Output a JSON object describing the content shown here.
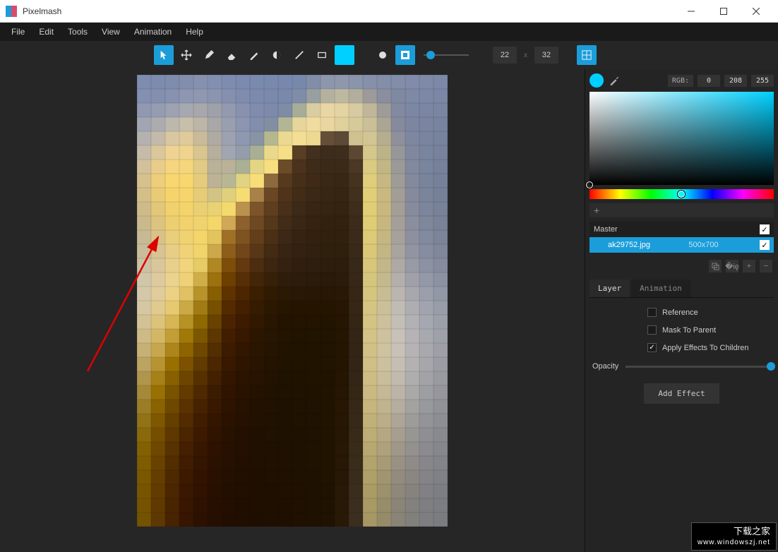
{
  "window": {
    "title": "Pixelmash"
  },
  "menu": {
    "file": "File",
    "edit": "Edit",
    "tools": "Tools",
    "view": "View",
    "animation": "Animation",
    "help": "Help"
  },
  "toolbar": {
    "dim_w": "22",
    "dim_x": "x",
    "dim_h": "32",
    "color": "#00d0ff"
  },
  "color_panel": {
    "mode_label": "RGB:",
    "r": "0",
    "g": "208",
    "b": "255",
    "swatch": "#00d0ff"
  },
  "layers": {
    "master": {
      "name": "Master"
    },
    "items": [
      {
        "name": "ak29752.jpg",
        "dim": "500x700"
      }
    ]
  },
  "tabs": {
    "layer": "Layer",
    "animation": "Animation"
  },
  "layer_props": {
    "reference": "Reference",
    "mask": "Mask To Parent",
    "apply": "Apply Effects To Children",
    "opacity_label": "Opacity",
    "add_effect": "Add Effect"
  },
  "watermark": {
    "line1": "下载之家",
    "line2": "www.windowszj.net"
  },
  "pixel_image": {
    "width": 22,
    "height": 32,
    "rows": [
      "7e8cb0 7d8baf 7f8cae 838ead 8691b0 828fb1 7e8caf 7b8aae 7a8aaf 7989ae 7888ad 7888ab 828ea8 8c96ac 8e97ab 8a94aa 8690a9 838ea9 828daa 808ca9 7e8aa8 7c88a7",
      "8490b0 838fae 8692af 8d97b1 8f98b0 8b95af 8490ae 7f8cad 7c8aad 7a89ac 7989ab 808da8 97a09f b4b29f bdb8a0 b2ae9e 9c9a9a 8a8e9e 8089a2 7e89a6 7c88a6 7a87a5",
      "9199b2 949cb2 9ca2b2 a6a8b0 a7a7ac 9fa1aa 939ab0 8892ae 808cac 7d8aab 7e8ca6 a7ad97 d9cda1 e8d6a4 e5d4a3 d8caa0 c0b79a 9e9c98 8289a0 7c87a4 7a86a3 7986a2",
      "a2a6b3 acacb0 bdb8ae c7beab bcb5a8 a9a7a7 9a9fb0 8c95b1 828eac 828fa2 b2b695 e6d69b f1dca0 ead79f e0d09c d6c99a cabf98 aaa693 858a9c 7c86a1 7985a1 77849f",
      "b4b1b0 c4baa9 d9c7a2 dfca9c c9bb9a afaba2 9da2b1 8f98b1 8893a3 b5b88f ebd991 f4de93 eed992 664f38 5c4936 cfc291 d2c593 b5ae8e 8e919b 7d87a0 79859f 77839d",
      "c5bba8 dac79c eed393 f0d48d d9c590 b5af9c a2a6b2 959daa a9af94 ead98a f6de87 583e24 432f1d 3d2c1b 3d2d1c 5c4832 d5c68b bcb389 969799 7f889f 79859e 77839c",
      "d2c19b e8cd8a f5d67e f5d67c e1ca85 bab199 a9abafa aab094 e3d585 f7df80 6a4c28 4b321c 3f2b19 3c2a18 3b2a18 4a3824 dbca82 c1b685 9b9a99 81899e 79859c 76829a",
      "d6c08d ecce7b f8d670 f8d770 e5cc7c bdb296 b8b795 e0d381 f7de78 8c6a3e 573a1e 462f19 3e2a17 3a2816 392715 453320 e0cd7c c6b882 9f9c97 838a9d 79849b 768199",
      "d4bf89 e9cb77 f6d46c f7d56c e6cc78 d2c484 e0d07e f6dc72 a88148 6a4623 4f341a 422c17 3b2816 382614 372513 41301d e2ce78 c8b980 a29d96 858b9c 7a849b 768198",
      "cfbb89 e2c779 f1d16d f4d36b ead073 e8d273 f4d96c bb914e 7d5429 5e3e1e 49301a 3d2917 382513 352412 352311 3f2d1b e1cd75 c8b87f a39e96 878c9c 7c859b 778197",
      "cab98d dcc480 edcf72 f2d26d efd36e f4d768 d0a856 8e602d 6e4822 543819 432c17 3a2614 352311 332110 32210f 3c2b1a dfcc75 c6b780 a49f98 8a8e9d 7e879c 798297",
      "c7b993 d8c288 e9ce7b f0d271 f3d56a e4c45d a07028 7f5221 623f1a 4b3016 3c2815 362312 332110 31200e 31200e 3b2a19 ddca77 c5b682 a6a19b 8d909f 818a9e 7b8498",
      "c8bc9b d7c393 e7cd85 f0d378 f2d46c cca84a 8d5d1a 71461a 573715 432a13 382413 332111 31200f 2f1f0d 2f1f0d 392919 dac878 c3b685 a9a49f 9294a2 868da1 7f879a",
      "ccc1a3 d9c79b e8cf8c f1d47c e7cb65 b08823 7d4e0a 64390f 4c2d0f 3d2510 342110 301f0f 2e1e0e 2d1d0c 2d1d0c 382818 d8c77a c3b789 aea9a4 989aa6 8c92a4 848c9e",
      "d1c6a8 ddcb9f ebd28e efd178 cfae47 9b720d 6d3f00 582e06 432608 362008 2f1d0b 2d1c0b 2b1b0a 2a1a09 2b1b0a 372717 d6c67c c4b98e b3afaa 9fa0aa 9399a8 8b92a2",
      "d4c8a8 e0cc9b ecd185 e0c163 b8932a 885f00 5f3300 4d2500 3b1f01 301b02 2a1905 291806 281705 271704 281805 362616 d5c67f c7bc93 bab5af a7a7af 9a9fab 9298a5",
      "d5c7a1 e0ca8f e6c970 cba945 a27b14 775000 542a00 441f00 351b00 2c1800 261600 251500 251500 241500 261603 352616 d4c582 cabf98 c0bbb3 aeadb2 a1a4ae 989dA8",
      "d3c295 dcc37b d6b654 b69124 8f6801 694200 4b2300 3e1b00 311800 281600 231400 221400 221400 221400 251502 342515 d4c484 ccc19c c4bfb6 b2b1b4 a5a8b0 9ca0a9",
      "ceba86 d3b766 c29e36 a07908 7d5700 5c3700 421e00 371800 2d1600 261500 221400 211300 211400 211400 241501 332515 d3c386 cec29e c7c1b7 b5b3b5 a8a9af 9ea1a9",
      "c6b075 c6a74e ad851a 8d6400 6e4800 522e00 3d1b00 321600 2a1500 241400 211300 201300 201300 211400 241501 332515 d1c187 cec29f c7c1b6 b5b3b4 a8a8ae 9e9fa7",
      "bba362 b79431 997000 7c5200 613b00 4a2700 381900 2e1500 281400 231300 201300 201300 201300 211400 241501 332516 cfbf86 ccc09e c5beb3 b3b1b2 a6a6ab 9c9da4",
      "b0954d a78018 886000 6e4500 573000 432100 331600 2b1300 261300 221200 201200 1f1300 201300 201300 251501 342616 cdbd84 c9bd9a c1bbae afaeae a2a2a7 999aa0",
      "a58939 987003 7a5300 633a00 4e2800 3c1c00 301400 291200 241200 211200 1f1200 1f1200 1f1300 201300 251502 352716 cab981 c5b895 bcb5a7 aaa8a8 9d9ea2 96969c",
      "9b7d27 8a6200 6f4800 5a3200 472200 381900 2d1300 271100 231100 211100 1f1100 1f1200 1f1200 201300 261602 362817 c6b67d c0b38e b5ae9f a4a2a1 98999d 919297",
      "927217 7e5700 653f00 522b00 411d00 341600 2b1200 261100 221100 201100 1f1100 1f1200 1f1200 201300 261603 372918 c1b178 bbad88 ada697 9e9c9a 939498 8d8e93",
      "8a690b 754e00 5e3800 4b2500 3c1a00 311400 291100 241000 211000 201100 1f1100 1f1100 1f1200 201300 261704 382a19 bdac74 b5a782 a69f90 989693 8f8f93 898a8f",
      "836103 6e4800 583200 451f00 381700 2e1200 271000 231000 211000 201000 1f1000 1f1100 1f1200 201300 271704 382b1a b8a770 aea17b 9f9889 93908d 8b8b8f 86878c",
      "7e5c00 694200 522d00 411c00 341500 2b1100 261000 220f00 201000 1f1000 1f1000 1f1100 1f1200 201300 271705 392c1b b3a36c a79a75 999284 8e8b88 87878b 838489",
      "7a5800 643e00 4e2900 3d1900 311300 2a1000 240f00 210f00 200f00 1f1000 1f1000 1f1100 1f1100 201300 271806 3a2c1c af9f69 a19470 938c7e 8a8783 848488 808186",
      "775500 613b00 4b2600 3a1700 2f1200 281000 230f00 210f00 1f0f00 1f0f00 1f1000 1f1000 1f1100 201200 281806 3a2d1d ab9c66 9c906d 8e887a 86837f 818185 7d7e84",
      "755300 5f3900 492400 381600 2e1100 270f00 230e00 200e00 1f0f00 1f0f00 1f0f00 1f1000 1f1100 201200 281907 3b2e1e a89965 988d6a 8b8578 83817d 7f7f83 7b7d82",
      "735200 5d3800 482300 371500 2d1100 260f00 220e00 200e00 1f0e00 1f0f00 1f0f00 1f1000 1f1100 201200 281907 3b2e1f a69764 968b69 898476 82807c 7e7e82 7a7c81"
    ]
  }
}
